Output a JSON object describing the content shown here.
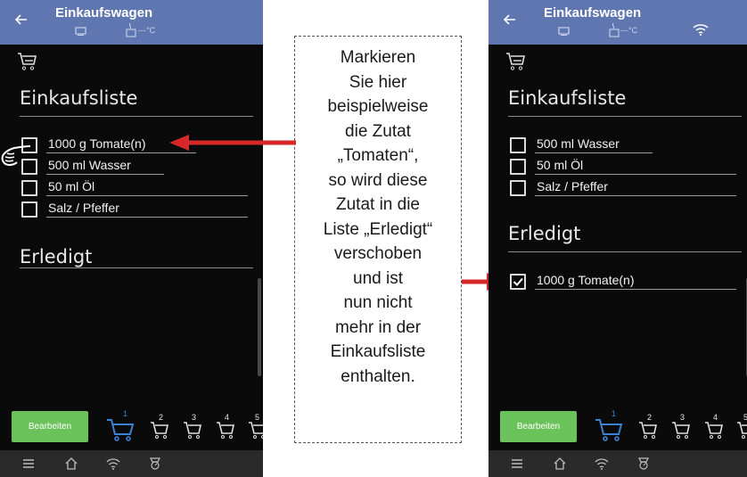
{
  "colors": {
    "header": "#5f76b0",
    "edit_button": "#6cc25a",
    "active_cart": "#3b82d6",
    "arrow": "#d62828"
  },
  "left_screen": {
    "header": {
      "title": "Einkaufswagen",
      "temperature": "---°C"
    },
    "shopping_list": {
      "heading": "Einkaufsliste",
      "items": [
        {
          "label": "1000 g Tomate(n)",
          "checked": false
        },
        {
          "label": "500 ml Wasser",
          "checked": false
        },
        {
          "label": "50 ml Öl",
          "checked": false
        },
        {
          "label": "Salz / Pfeffer",
          "checked": false
        }
      ]
    },
    "done": {
      "heading": "Erledigt",
      "items": []
    },
    "edit_button": "Bearbeiten",
    "cart_tabs": [
      "1",
      "2",
      "3",
      "4",
      "5"
    ]
  },
  "right_screen": {
    "header": {
      "title": "Einkaufswagen",
      "temperature": "---°C"
    },
    "shopping_list": {
      "heading": "Einkaufsliste",
      "items": [
        {
          "label": "500 ml Wasser",
          "checked": false
        },
        {
          "label": "50 ml Öl",
          "checked": false
        },
        {
          "label": "Salz / Pfeffer",
          "checked": false
        }
      ]
    },
    "done": {
      "heading": "Erledigt",
      "items": [
        {
          "label": "1000 g Tomate(n)",
          "checked": true
        }
      ]
    },
    "edit_button": "Bearbeiten",
    "cart_tabs": [
      "1",
      "2",
      "3",
      "4",
      "5"
    ]
  },
  "callout": {
    "lines": [
      "Markieren",
      "Sie hier",
      "beispielweise",
      "die Zutat",
      "„Tomaten“,",
      "so wird diese",
      "Zutat in die",
      "Liste „Erledigt“",
      "verschoben",
      "und ist",
      "nun nicht",
      "mehr in der",
      "Einkaufsliste",
      "enthalten."
    ]
  },
  "icons": {
    "header": [
      "back-arrow-icon",
      "kitchen-scale-icon",
      "pot-icon",
      "wifi-icon"
    ],
    "bottom_bar": [
      "menu-icon",
      "home-icon",
      "wifi-icon",
      "scale-icon"
    ]
  }
}
